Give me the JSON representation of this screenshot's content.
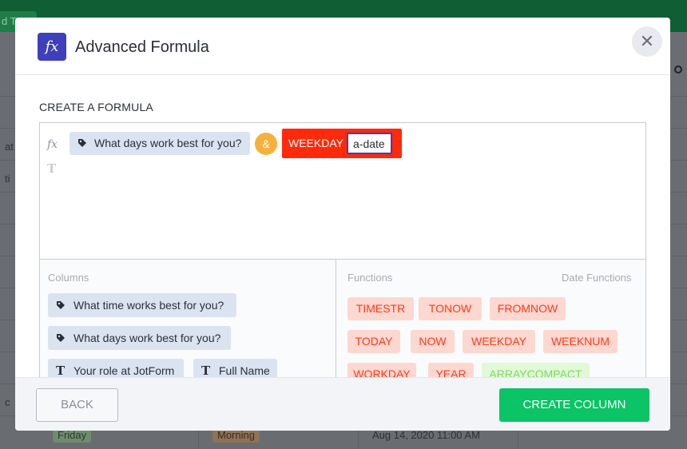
{
  "background": {
    "top_button_label": "d T",
    "row_cells": [
      "Friday",
      "Morning",
      "Aug 14, 2020 11:00 AM"
    ],
    "partial_labels": [
      "at",
      "ti",
      "c"
    ]
  },
  "modal": {
    "badge_glyph": "fx",
    "title": "Advanced Formula",
    "close_glyph": "✕",
    "section_label": "CREATE A FORMULA"
  },
  "formula": {
    "side_fx_glyph": "fx",
    "side_t_glyph": "T",
    "column_token": "What days work best for you?",
    "operator": "&",
    "function_name": "WEEKDAY",
    "function_arg": "a-date"
  },
  "columns_panel": {
    "title": "Columns",
    "items": [
      {
        "label": "What time works best for you?",
        "icon": "tag-icon"
      },
      {
        "label": "What days work best for you?",
        "icon": "tag-icon"
      },
      {
        "label": "Your role at JotForm",
        "icon": "text-icon"
      },
      {
        "label": "Full Name",
        "icon": "text-icon"
      }
    ]
  },
  "functions_panel": {
    "title": "Functions",
    "category": "Date Functions",
    "chips": [
      "TIMESTR",
      "TONOW",
      "FROMNOW",
      "TODAY",
      "NOW",
      "WEEKDAY",
      "WEEKNUM",
      "WORKDAY",
      "YEAR",
      "ARRAYCOMPACT"
    ]
  },
  "footer": {
    "back_label": "BACK",
    "create_label": "CREATE COLUMN"
  },
  "colors": {
    "accent": "#3e3fbb",
    "function_red": "#ff2a0b",
    "operator_orange": "#f6b13d",
    "create_green": "#0ac465",
    "chip_red_bg": "#fcd8d1",
    "chip_green_bg": "#e0fad7"
  }
}
